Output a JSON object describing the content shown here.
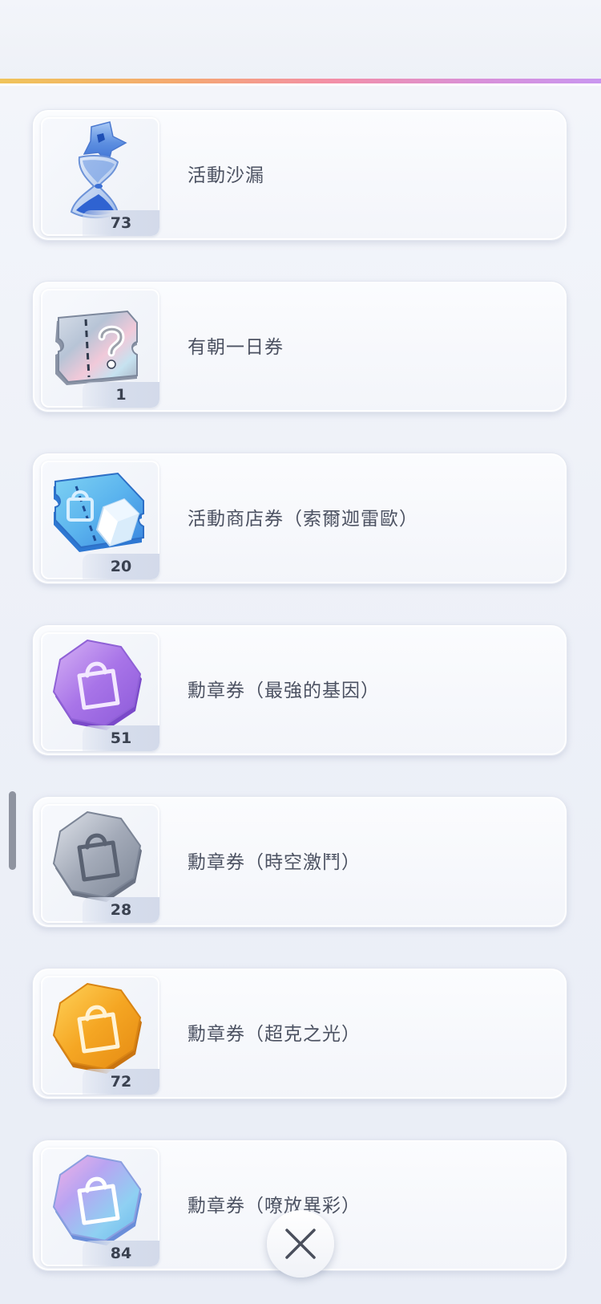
{
  "items": [
    {
      "name": "活動沙漏",
      "quantity": "73",
      "icon": "hourglass-icon"
    },
    {
      "name": "有朝一日券",
      "quantity": "1",
      "icon": "mystery-ticket-icon"
    },
    {
      "name": "活動商店券（索爾迦雷歐）",
      "quantity": "20",
      "icon": "shop-ticket-icon"
    },
    {
      "name": "勳章券（最強的基因）",
      "quantity": "51",
      "icon": "medal-ticket-purple-icon"
    },
    {
      "name": "勳章券（時空激鬥）",
      "quantity": "28",
      "icon": "medal-ticket-silver-icon"
    },
    {
      "name": "勳章券（超克之光）",
      "quantity": "72",
      "icon": "medal-ticket-gold-icon"
    },
    {
      "name": "勳章券（嘹放異彩）",
      "quantity": "84",
      "icon": "medal-ticket-rainbow-icon"
    }
  ],
  "close_button": {
    "icon": "close-icon"
  },
  "colors": {
    "accent_gradient": [
      "#f0c45a",
      "#f38fa6",
      "#c996f0"
    ],
    "text": "#4c5262"
  }
}
